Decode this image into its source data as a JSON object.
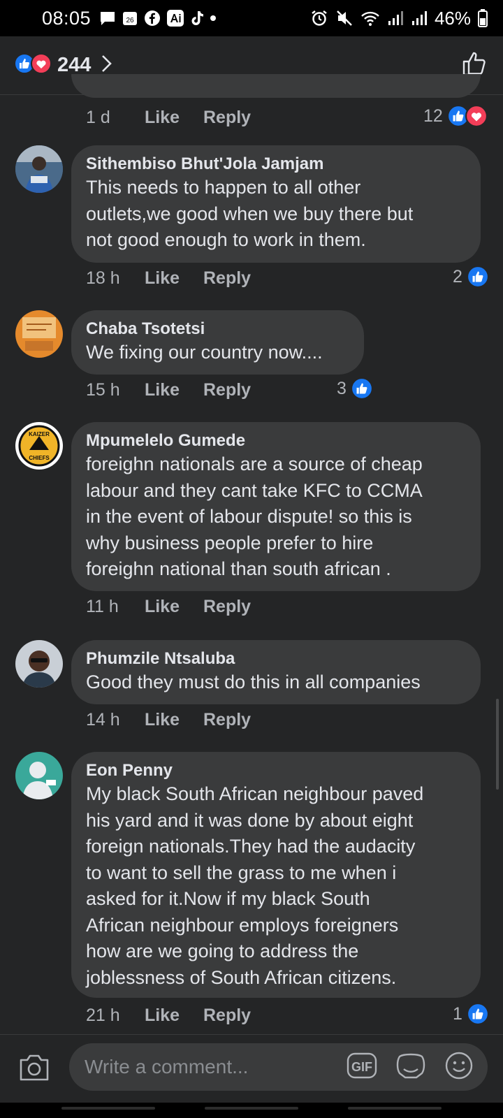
{
  "status_bar": {
    "time": "08:05",
    "calendar_day": "26",
    "battery": "46%"
  },
  "header": {
    "reaction_count": "244"
  },
  "prev_comment": {
    "time": "1 d",
    "like": "Like",
    "reply": "Reply",
    "reactions": "12"
  },
  "comments": [
    {
      "author": "Sithembiso Bhut'Jola Jamjam",
      "lines": [
        "This needs to happen to all other",
        "outlets,we good when we buy there but",
        "not good enough to work in them."
      ],
      "time": "18 h",
      "like": "Like",
      "reply": "Reply",
      "reactions": "2"
    },
    {
      "author": "Chaba Tsotetsi",
      "lines": [
        "We fixing our country now...."
      ],
      "time": "15 h",
      "like": "Like",
      "reply": "Reply",
      "reactions": "3"
    },
    {
      "author": "Mpumelelo Gumede",
      "lines": [
        "foreighn nationals are a source of cheap",
        "labour and they cant take KFC to CCMA",
        "in the event of labour dispute! so this is",
        "why business people prefer to hire",
        "foreighn national than south african ."
      ],
      "time": "11 h",
      "like": "Like",
      "reply": "Reply",
      "reactions": ""
    },
    {
      "author": "Phumzile Ntsaluba",
      "lines": [
        "Good they must do this in all companies"
      ],
      "time": "14 h",
      "like": "Like",
      "reply": "Reply",
      "reactions": ""
    },
    {
      "author": "Eon Penny",
      "lines": [
        "My black South African neighbour paved",
        "his yard and it was done by about eight",
        "foreign nationals.They had the audacity",
        "to want to sell the grass to me when i",
        "asked for it.Now if my black South",
        "African neighbour employs foreigners",
        "how are we going to address the",
        "joblessness of South African citizens."
      ],
      "time": "21 h",
      "like": "Like",
      "reply": "Reply",
      "reactions": "1"
    }
  ],
  "avatar_texts": {
    "kaizer_top": "KAIZER",
    "kaizer_bottom": "CHIEFS"
  },
  "composer": {
    "placeholder": "Write a comment...",
    "gif": "GIF"
  },
  "colors": {
    "like_blue": "#1877f2",
    "love_red": "#f33e58",
    "bubble": "#3a3b3c",
    "background": "#242526"
  }
}
